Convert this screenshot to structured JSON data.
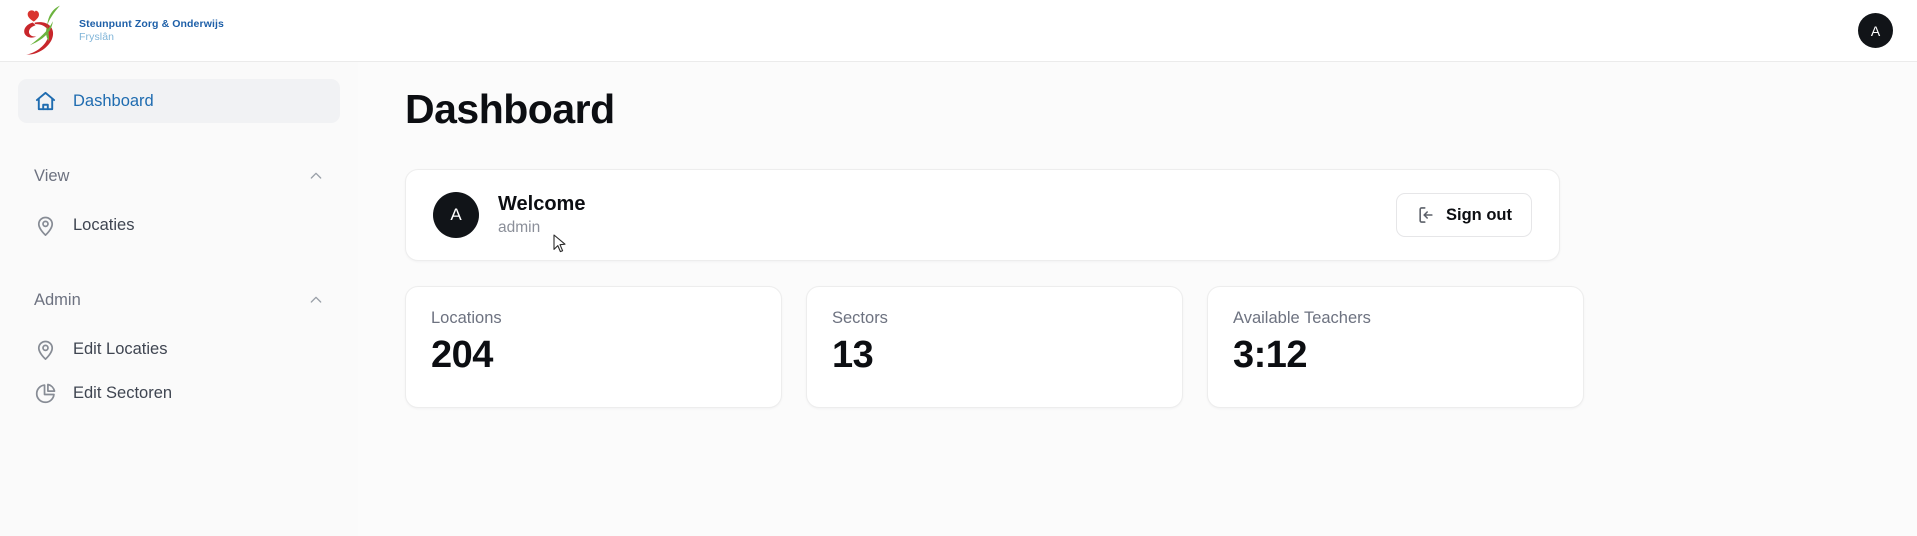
{
  "topbar": {
    "logo_line1": "Steunpunt Zorg & Onderwijs",
    "logo_line2": "Fryslân",
    "logo_icon": "swoosh-heart-logo",
    "avatar_initial": "A"
  },
  "sidebar": {
    "dashboard": {
      "label": "Dashboard",
      "icon": "home-icon"
    },
    "groups": [
      {
        "label": "View",
        "chevron_icon": "chevron-up-icon",
        "items": [
          {
            "label": "Locaties",
            "icon": "map-pin-icon"
          }
        ]
      },
      {
        "label": "Admin",
        "chevron_icon": "chevron-up-icon",
        "items": [
          {
            "label": "Edit Locaties",
            "icon": "map-pin-icon"
          },
          {
            "label": "Edit Sectoren",
            "icon": "pie-chart-icon"
          }
        ]
      }
    ]
  },
  "main": {
    "page_title": "Dashboard",
    "welcome": {
      "avatar_initial": "A",
      "title": "Welcome",
      "username": "admin",
      "signout_label": "Sign out",
      "signout_icon": "logout-icon"
    },
    "stats": [
      {
        "label": "Locations",
        "value": "204"
      },
      {
        "label": "Sectors",
        "value": "13"
      },
      {
        "label": "Available Teachers",
        "value": "3:12"
      }
    ]
  },
  "colors": {
    "accent_blue": "#1f6cb0",
    "logo_blue": "#1d5fa8",
    "logo_sub_blue": "#7fb4d8",
    "logo_red": "#d5282a",
    "logo_green": "#5aa832",
    "avatar_bg": "#111418",
    "text_primary": "#0c0e12",
    "text_muted": "#6d7280",
    "page_bg": "#fbfbfb",
    "sidebar_bg": "#fafafa"
  }
}
